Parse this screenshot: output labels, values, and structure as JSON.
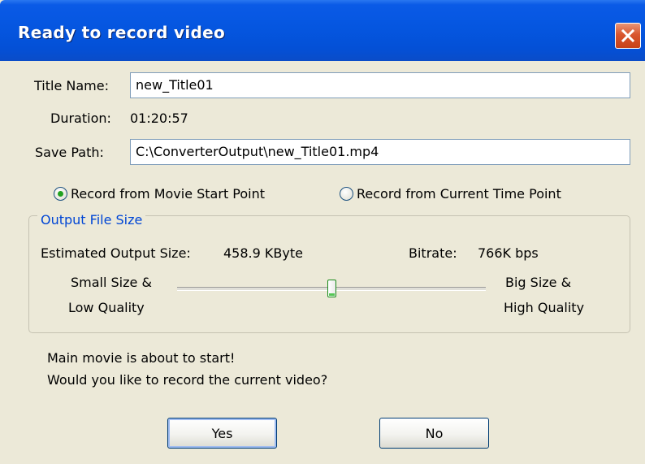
{
  "window": {
    "title": "Ready to record video"
  },
  "form": {
    "title_name_label": "Title Name:",
    "title_name_value": "new_Title01",
    "duration_label": "Duration:",
    "duration_value": "01:20:57",
    "save_path_label": "Save Path:",
    "save_path_value": "C:\\ConverterOutput\\new_Title01.mp4"
  },
  "record_options": {
    "selected": "start",
    "start_label": "Record from Movie Start Point",
    "current_label": "Record from Current Time Point"
  },
  "output": {
    "group_label": "Output File Size",
    "estimated_label": "Estimated Output Size:",
    "estimated_value": "458.9 KByte",
    "bitrate_label": "Bitrate:",
    "bitrate_value": "766K bps",
    "slider_left_line1": "Small Size &",
    "slider_left_line2": "Low Quality",
    "slider_right_line1": "Big Size &",
    "slider_right_line2": "High Quality",
    "slider_level": 0.5
  },
  "message": {
    "line1": "Main movie is about to start!",
    "line2": "Would you like to record the current video?"
  },
  "buttons": {
    "yes": "Yes",
    "no": "No"
  },
  "icons": {
    "close": "close-icon"
  },
  "colors": {
    "titlebar": "#0556e0",
    "close": "#d9552d",
    "group_label": "#0046d5",
    "radio_dot": "#21a121"
  }
}
